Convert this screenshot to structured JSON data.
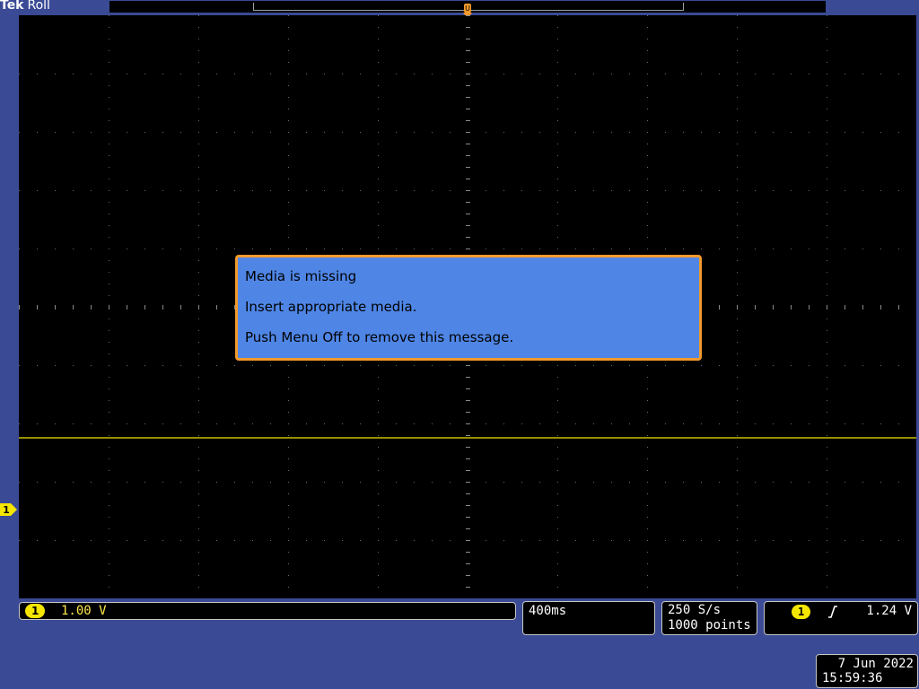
{
  "header": {
    "brand": "Tek",
    "mode": "Roll"
  },
  "trigger_position_label": "U",
  "dialog": {
    "line1": "Media is missing",
    "line2": "Insert appropriate media.",
    "line3": "Push Menu Off to remove this message."
  },
  "channel": {
    "number": "1",
    "scale": "1.00 V",
    "color": "#f5e600"
  },
  "timebase": {
    "value": "400ms"
  },
  "acquisition": {
    "rate": "250 S/s",
    "points": "1000 points"
  },
  "trigger": {
    "source": "1",
    "level": "1.24 V",
    "slope_icon": "rising-edge-icon"
  },
  "datetime": {
    "date": "7 Jun 2022",
    "time": "15:59:36"
  },
  "colors": {
    "frame": "#3a4a95",
    "dialog_bg": "#4f86e6",
    "dialog_border": "#f39a2c",
    "trace": "#f5e600"
  }
}
